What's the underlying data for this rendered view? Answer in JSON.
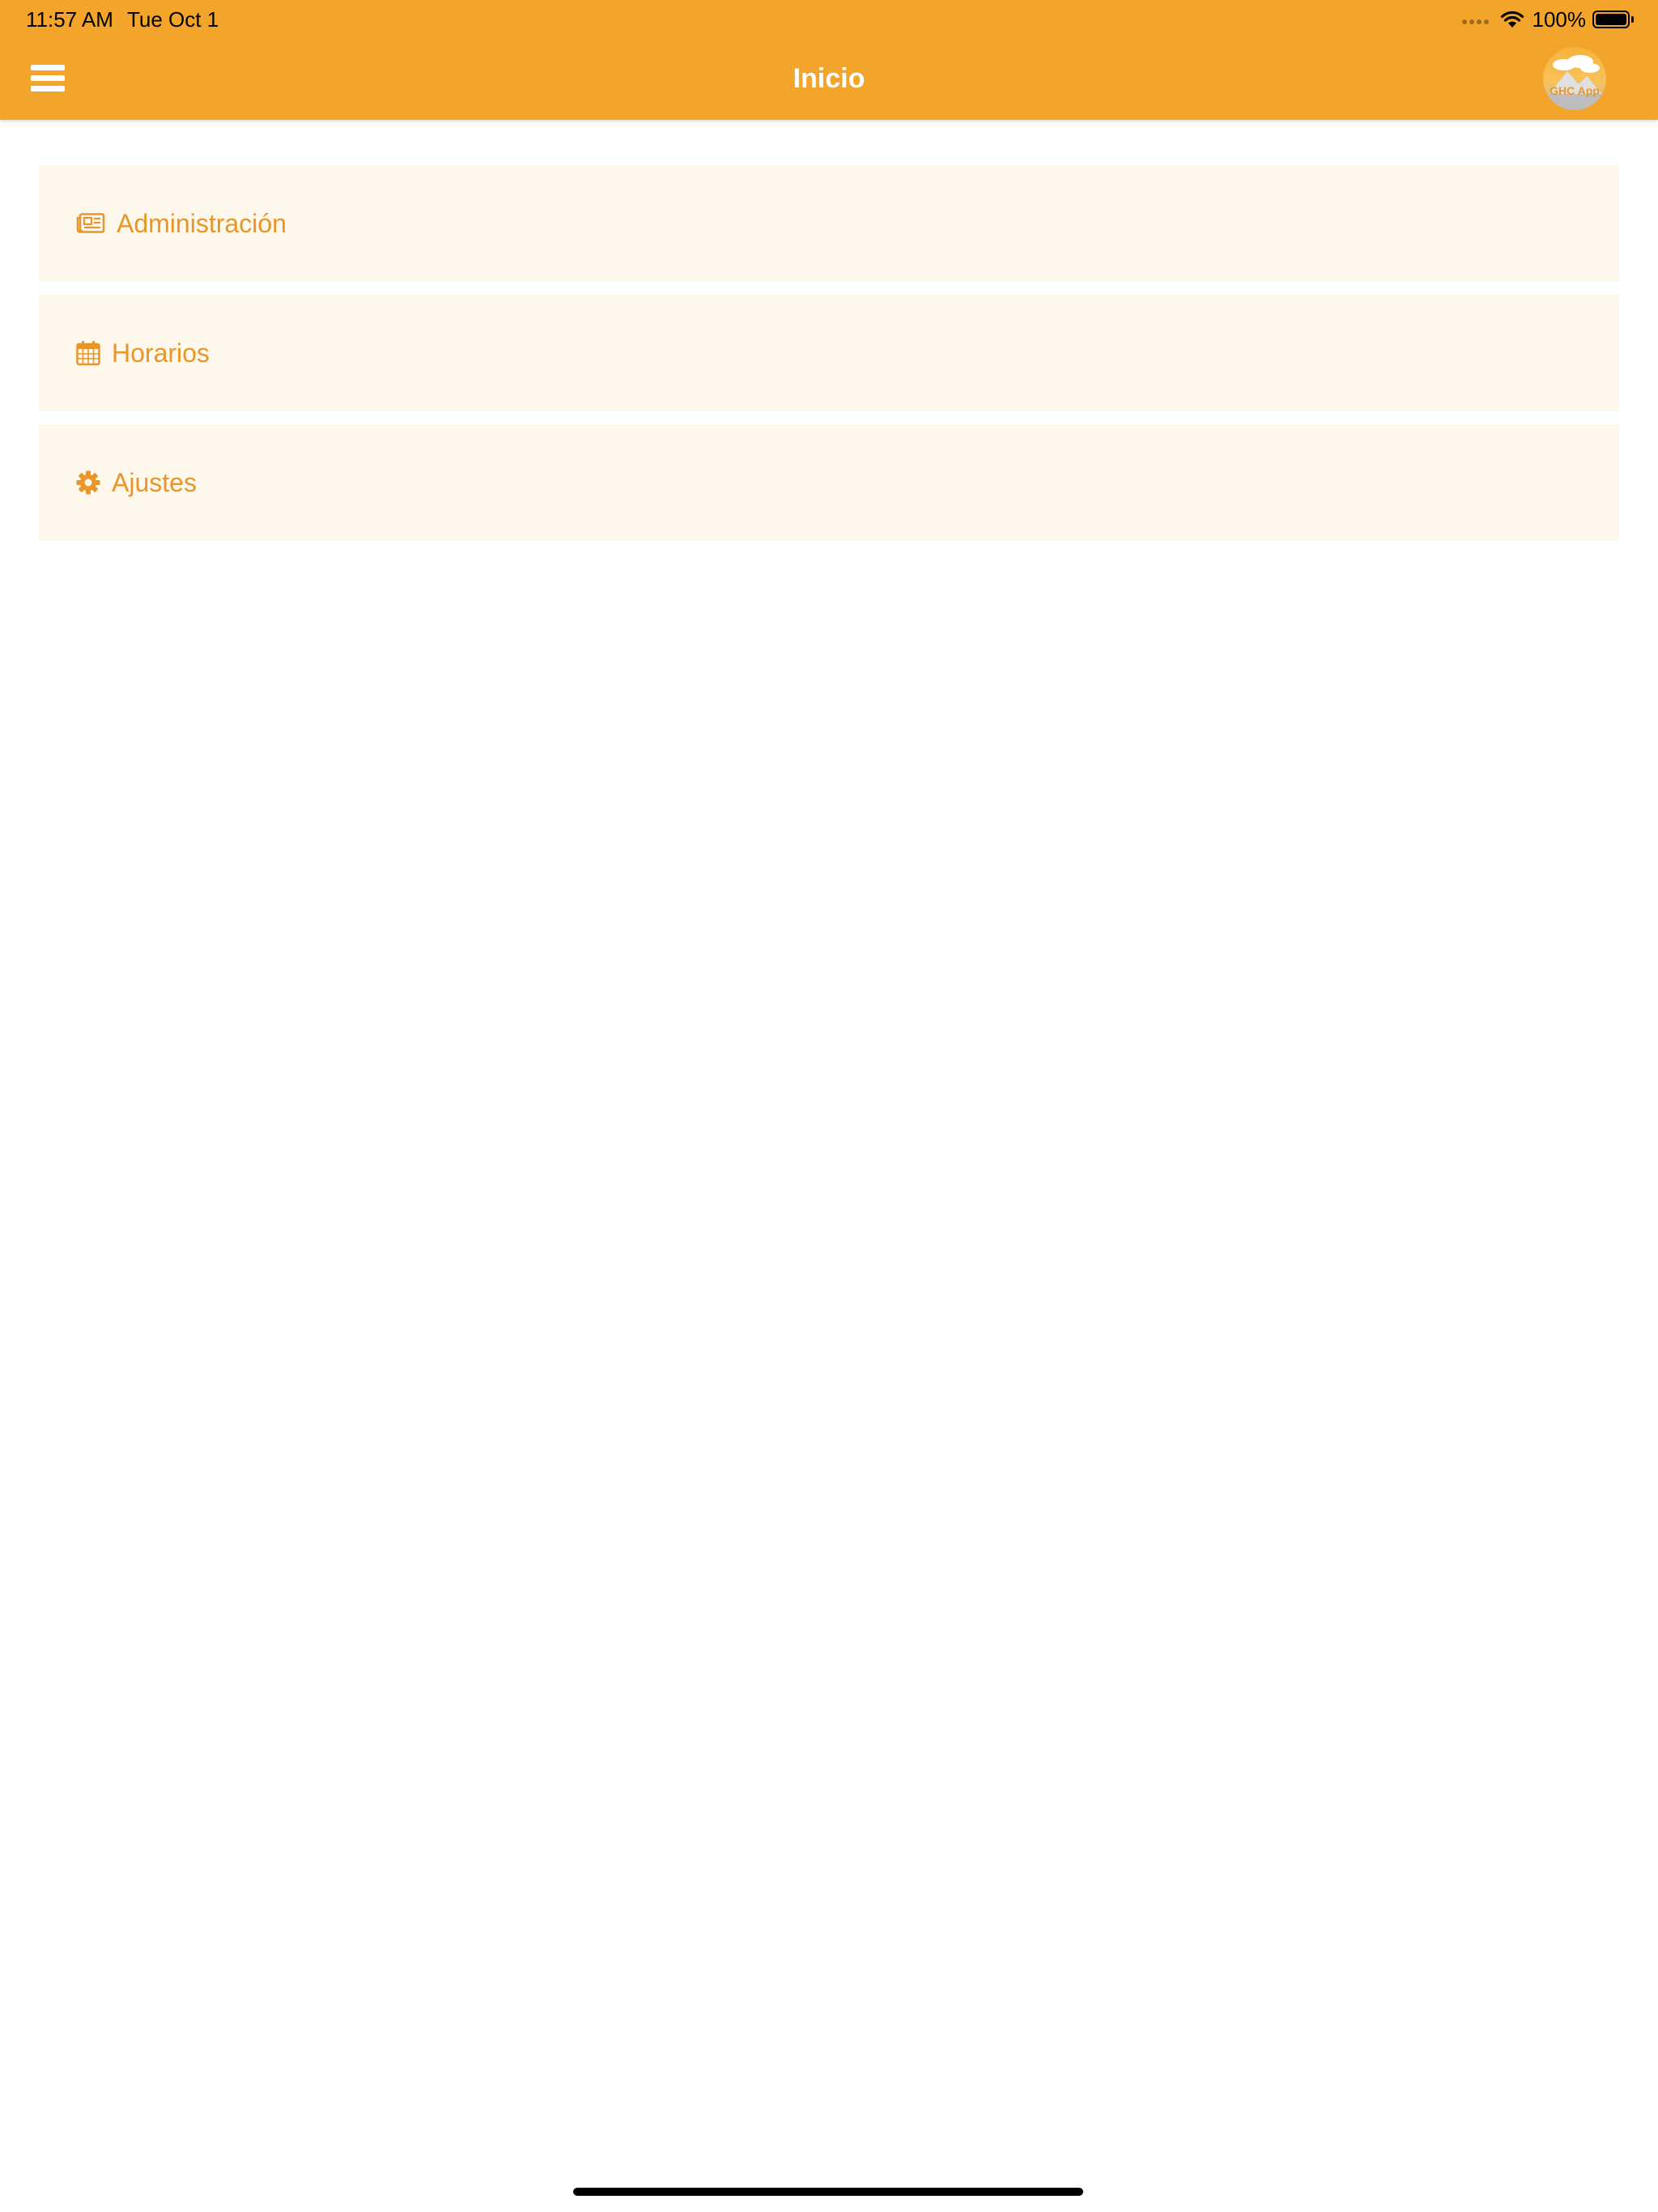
{
  "status_bar": {
    "time": "11:57 AM",
    "date": "Tue Oct 1",
    "battery_percent": "100%",
    "battery_level": 1.0,
    "signal_icon": "signal-dots-icon",
    "wifi_icon": "wifi-icon",
    "battery_icon": "battery-icon"
  },
  "header": {
    "title": "Inicio",
    "menu_icon": "hamburger-menu-icon",
    "logo_text": "GHC App",
    "background_color": "#F3A42A"
  },
  "menu": {
    "items": [
      {
        "label": "Administración",
        "icon": "newspaper-icon"
      },
      {
        "label": "Horarios",
        "icon": "calendar-icon"
      },
      {
        "label": "Ajustes",
        "icon": "gear-icon"
      }
    ],
    "item_background": "#FEF8EC",
    "accent_color": "#E8962A"
  }
}
